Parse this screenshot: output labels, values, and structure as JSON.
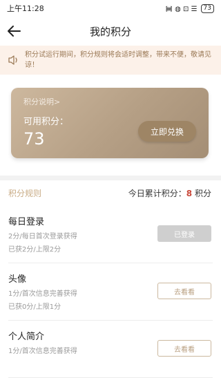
{
  "status_bar": {
    "time": "上午11:28",
    "signal_text": "᯼ ◍ ⊡ ☰",
    "battery": "73"
  },
  "header": {
    "title": "我的积分"
  },
  "notice": {
    "text": "积分试运行期间，积分规则将会适时调整，带来不便，敬请见谅！",
    "icon": "speaker-icon"
  },
  "points_card": {
    "description_link": "积分说明>",
    "available_label": "可用积分：",
    "available_value": "73",
    "redeem_button": "立即兑换"
  },
  "rules": {
    "title": "积分规则",
    "today_label": "今日累计积分：",
    "today_value": "8",
    "today_unit": "积分"
  },
  "tasks": [
    {
      "name": "每日登录",
      "rule": "2分/每日首次登录获得",
      "progress": "已获2分/上限2分",
      "button": "已登录",
      "state": "done"
    },
    {
      "name": "头像",
      "rule": "1分/首次信息完善获得",
      "progress": "已获0分/上限1分",
      "button": "去看看",
      "state": "go"
    },
    {
      "name": "个人简介",
      "rule": "1分/首次信息完善获得",
      "progress": "",
      "button": "去看看",
      "state": "go"
    }
  ],
  "colors": {
    "accent": "#c9ac86",
    "card": "#b59f85",
    "highlight": "#c9483a"
  }
}
